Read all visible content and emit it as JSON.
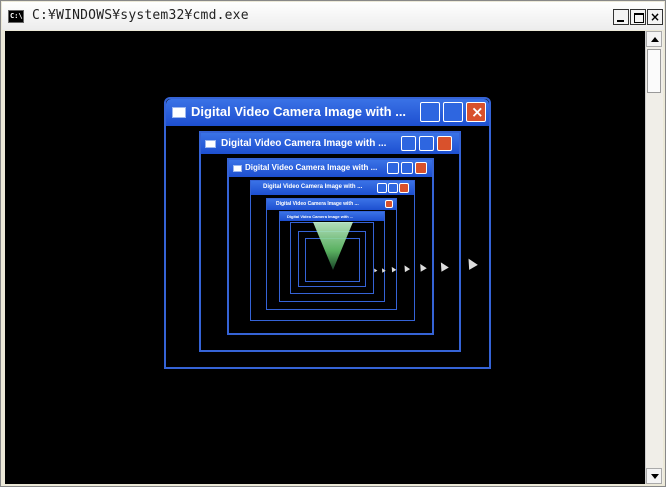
{
  "window": {
    "title": "C:¥WINDOWS¥system32¥cmd.exe",
    "icon_label": "C:\\",
    "buttons": {
      "minimize": "_",
      "maximize": "□",
      "close": "×"
    }
  },
  "video_window": {
    "title": "Digital Video Camera Image with ...",
    "nested_titles": [
      "Digital Video Camera Image with ...",
      "Digital Video Camera Image with ...",
      "Digital Video Camera Image with ...",
      "Digital Video Camera Image with ...",
      "Digital Video Camera Image with ..."
    ]
  },
  "colors": {
    "console_bg": "#000000",
    "xp_titlebar": "#2e62dc",
    "xp_close": "#d9512c",
    "tunnel_green": "#63c46a"
  },
  "icons": [
    "console-icon",
    "minimize-icon",
    "maximize-icon",
    "close-icon",
    "scroll-up-arrow-icon",
    "scroll-down-arrow-icon",
    "window-icon",
    "mouse-cursor-icon"
  ]
}
